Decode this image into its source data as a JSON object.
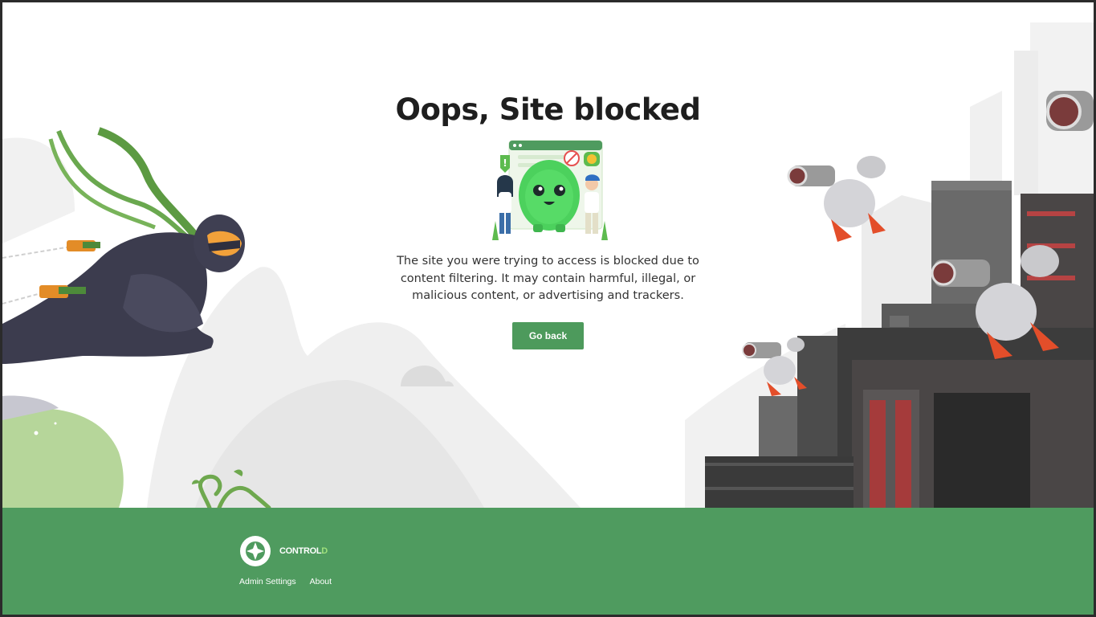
{
  "page": {
    "title": "Oops, Site blocked",
    "message": "The site you were trying to access is blocked due to content filtering. It may contain harmful, illegal, or malicious content, or advertising and trackers.",
    "go_back_label": "Go back"
  },
  "footer": {
    "brand": {
      "name_main": "CONTROL",
      "name_accent": "D"
    },
    "links": [
      {
        "label": "Admin Settings"
      },
      {
        "label": "About"
      }
    ]
  },
  "colors": {
    "accent": "#4d9a5c",
    "footer_bg": "#4f9b5f",
    "brand_accent": "#9fe07c",
    "title": "#1e1e1e"
  },
  "icons": [
    "controld-logo-icon",
    "ninja-illustration",
    "surveillance-drones-illustration",
    "blocked-site-mascot-illustration"
  ]
}
